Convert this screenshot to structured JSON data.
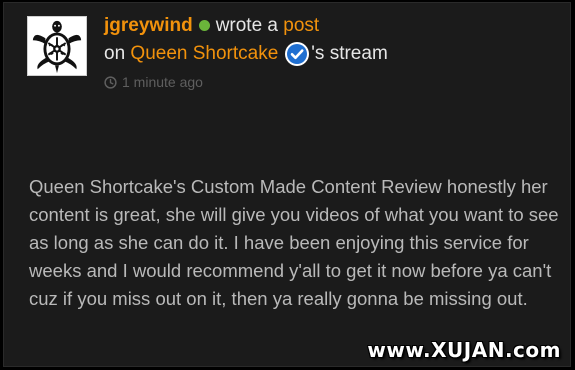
{
  "post": {
    "author": "jgreywind",
    "action_text": "wrote a",
    "action_link": "post",
    "on_text": "on",
    "stream_owner": "Queen Shortcake",
    "stream_suffix": "'s stream",
    "timestamp": "1 minute ago",
    "body": "Queen Shortcake's Custom Made Content Review honestly her content is great, she will give you videos of what you want to see as long as she can do it.  I have been enjoying this service for weeks and I would recommend y'all to get it now before ya can't cuz if you miss out on it, then ya really gonna be missing out.",
    "online_status": "online"
  },
  "watermark": "www.XUJAN.com",
  "icons": {
    "avatar": "turtle-tribal-avatar",
    "online": "online-status-dot",
    "verified": "verified-check-badge",
    "time": "clock-icon"
  },
  "colors": {
    "background": "#1b1b1b",
    "accent": "#f2920c",
    "online": "#6ab43a",
    "verified": "#1f6fd1",
    "body_text": "#b9b9b9",
    "muted": "#5f5f5f"
  }
}
